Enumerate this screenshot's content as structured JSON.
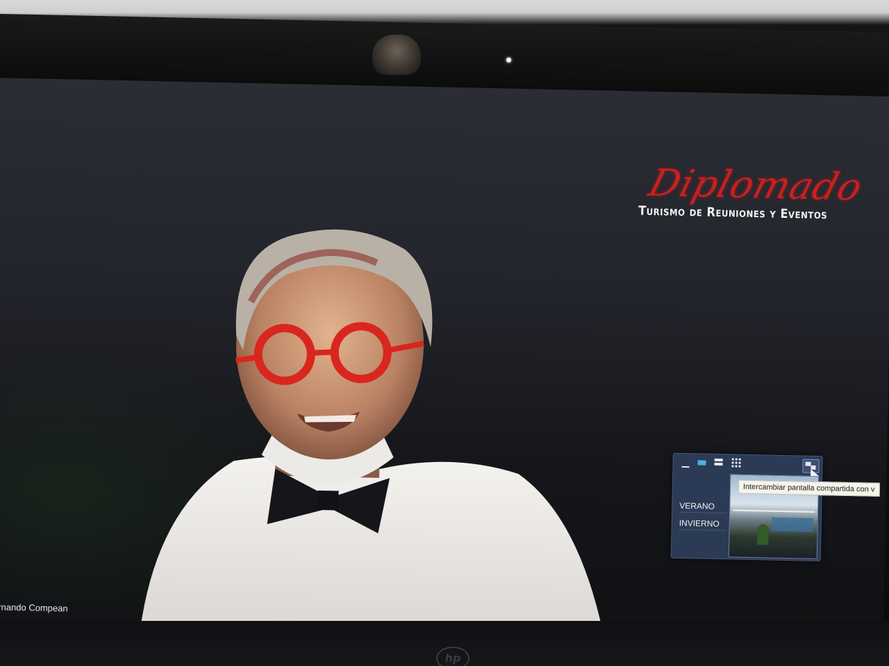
{
  "meeting": {
    "logo": {
      "script_text": "Diplomado",
      "subtitle": "Turismo de Reuniones y Eventos"
    },
    "participant_name": "ernando Compean",
    "mini_panel": {
      "toolbar": {
        "minimize_icon": "minimize-icon",
        "single_view_icon": "single-view-icon",
        "split_view_icon": "split-view-icon",
        "grid_view_icon": "grid-view-icon",
        "swap_icon": "swap-screen-icon"
      },
      "tooltip": "Intercambiar pantalla compartida con v",
      "menu": [
        "VERANO",
        "INVIERNO"
      ]
    }
  },
  "device": {
    "brand_badge": "hp"
  },
  "colors": {
    "logo_red": "#c8201f",
    "panel_bg": "#2c3b55",
    "active_view": "#4fb0e6"
  }
}
